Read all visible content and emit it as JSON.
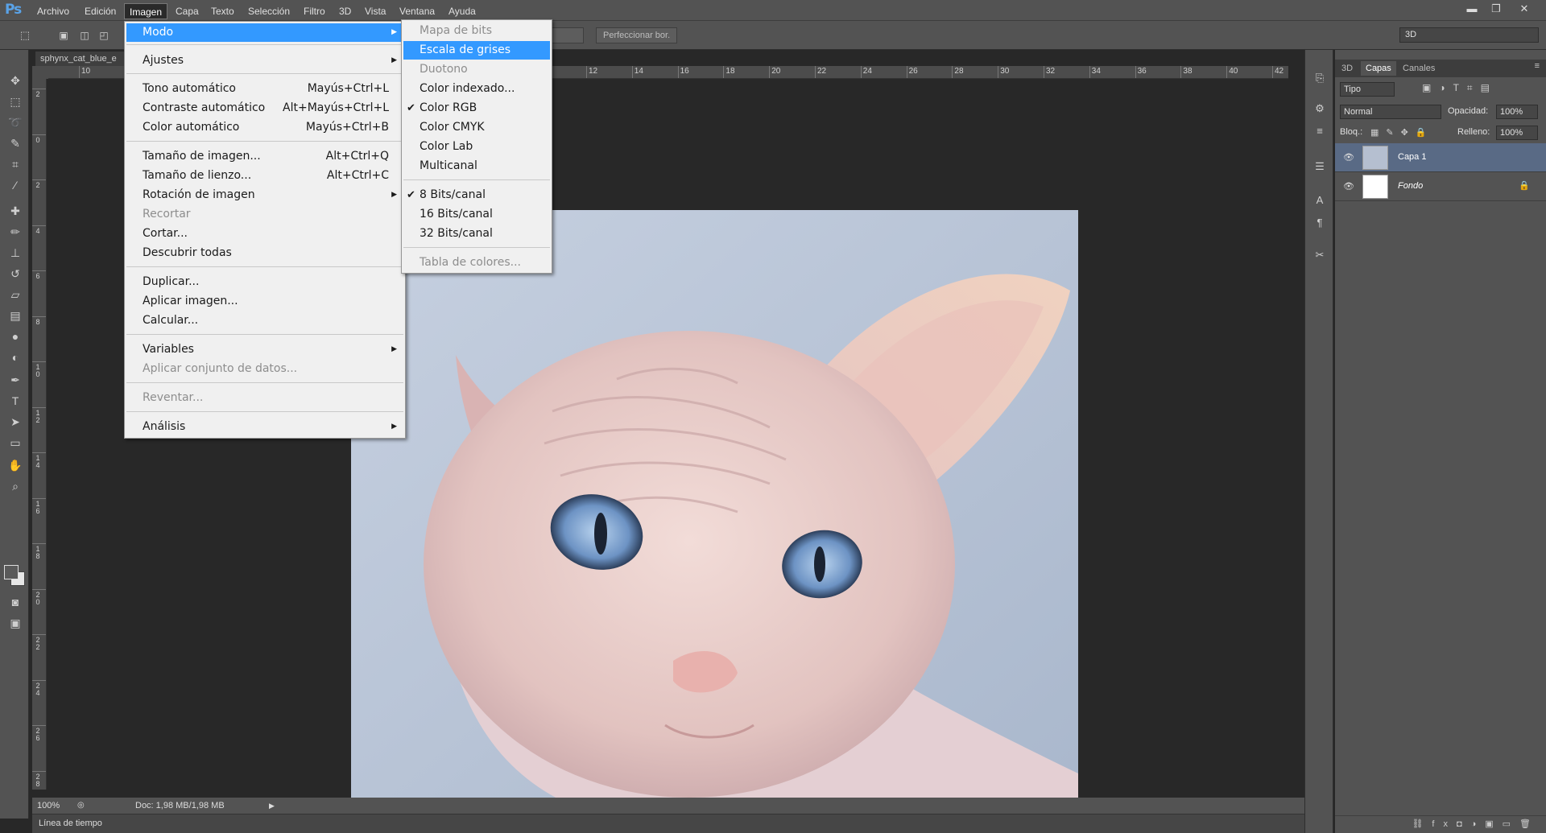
{
  "app": {
    "logo": "Ps"
  },
  "menubar": {
    "items": [
      "Archivo",
      "Edición",
      "Imagen",
      "Capa",
      "Texto",
      "Selección",
      "Filtro",
      "3D",
      "Vista",
      "Ventana",
      "Ayuda"
    ],
    "active": "Imagen"
  },
  "window_controls": {
    "minimize": "▬",
    "restore": "❐",
    "close": "✕"
  },
  "options_bar": {
    "refine_edge": "Perfeccionar bor.",
    "workspace": "3D"
  },
  "document": {
    "tab_title": "sphynx_cat_blue_e",
    "ruler_h_labels": [
      "10",
      "12",
      "14",
      "16",
      "18",
      "20",
      "22",
      "24",
      "26",
      "28",
      "30",
      "32",
      "34",
      "36",
      "38",
      "40",
      "42"
    ],
    "ruler_v_labels": [
      "2",
      "0",
      "2",
      "4",
      "6",
      "8",
      "10",
      "12",
      "14",
      "16",
      "18",
      "20",
      "22",
      "24",
      "26",
      "28"
    ]
  },
  "status": {
    "zoom": "100%",
    "doc_size": "Doc: 1,98 MB/1,98 MB"
  },
  "timeline": {
    "label": "Línea de tiempo"
  },
  "layers_panel": {
    "tabs": [
      "3D",
      "Capas",
      "Canales"
    ],
    "active_tab": "Capas",
    "filter": "Tipo",
    "blend_mode": "Normal",
    "opacity_label": "Opacidad:",
    "opacity": "100%",
    "lock_label": "Bloq.:",
    "fill_label": "Relleno:",
    "fill": "100%",
    "layers": [
      {
        "name": "Capa 1",
        "selected": true
      },
      {
        "name": "Fondo",
        "selected": false,
        "locked": true
      }
    ]
  },
  "menu_imagen": {
    "items": [
      {
        "label": "Modo",
        "submenu": true,
        "highlighted": true
      },
      {
        "label": "Ajustes",
        "submenu": true
      },
      {
        "label": "Tono automático",
        "shortcut": "Mayús+Ctrl+L"
      },
      {
        "label": "Contraste automático",
        "shortcut": "Alt+Mayús+Ctrl+L"
      },
      {
        "label": "Color automático",
        "shortcut": "Mayús+Ctrl+B"
      },
      {
        "label": "Tamaño de imagen...",
        "shortcut": "Alt+Ctrl+Q"
      },
      {
        "label": "Tamaño de lienzo...",
        "shortcut": "Alt+Ctrl+C"
      },
      {
        "label": "Rotación de imagen",
        "submenu": true
      },
      {
        "label": "Recortar",
        "disabled": true
      },
      {
        "label": "Cortar..."
      },
      {
        "label": "Descubrir todas"
      },
      {
        "label": "Duplicar..."
      },
      {
        "label": "Aplicar imagen..."
      },
      {
        "label": "Calcular..."
      },
      {
        "label": "Variables",
        "submenu": true
      },
      {
        "label": "Aplicar conjunto de datos...",
        "disabled": true
      },
      {
        "label": "Reventar...",
        "disabled": true
      },
      {
        "label": "Análisis",
        "submenu": true
      }
    ]
  },
  "menu_modo": {
    "items": [
      {
        "label": "Mapa de bits",
        "disabled": true
      },
      {
        "label": "Escala de grises",
        "highlighted": true
      },
      {
        "label": "Duotono",
        "disabled": true
      },
      {
        "label": "Color indexado..."
      },
      {
        "label": "Color RGB",
        "checked": true
      },
      {
        "label": "Color CMYK"
      },
      {
        "label": "Color Lab"
      },
      {
        "label": "Multicanal"
      },
      {
        "label": "8 Bits/canal",
        "checked": true
      },
      {
        "label": "16 Bits/canal"
      },
      {
        "label": "32 Bits/canal"
      },
      {
        "label": "Tabla de colores...",
        "disabled": true
      }
    ]
  },
  "colors": {
    "menu_highlight": "#3399ff",
    "layer_selected": "#596a85",
    "ps_blue": "#5aa3e8"
  }
}
